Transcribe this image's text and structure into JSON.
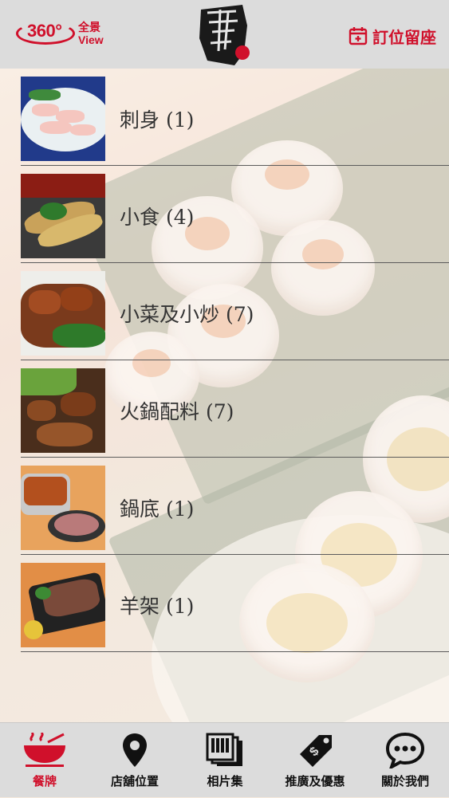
{
  "header": {
    "view360_number": "360°",
    "view360_label_line1": "全景",
    "view360_label_line2": "View",
    "reserve_label": "訂位留座",
    "accent_color": "#d0102b"
  },
  "menu": {
    "categories": [
      {
        "label": "刺身 (1)",
        "thumbnail": "sashimi-photo"
      },
      {
        "label": "小食 (4)",
        "thumbnail": "fried-snack-photo"
      },
      {
        "label": "小菜及小炒 (7)",
        "thumbnail": "stir-fry-photo"
      },
      {
        "label": "火鍋配料 (7)",
        "thumbnail": "hotpot-ingredients-photo"
      },
      {
        "label": "鍋底 (1)",
        "thumbnail": "soup-base-photo"
      },
      {
        "label": "羊架 (1)",
        "thumbnail": "lamb-rack-photo"
      }
    ]
  },
  "tabbar": {
    "tabs": [
      {
        "label": "餐牌",
        "icon": "bowl-icon",
        "active": true
      },
      {
        "label": "店舖位置",
        "icon": "map-pin-icon",
        "active": false
      },
      {
        "label": "相片集",
        "icon": "photo-gallery-icon",
        "active": false
      },
      {
        "label": "推廣及優惠",
        "icon": "price-tag-icon",
        "active": false
      },
      {
        "label": "關於我們",
        "icon": "chat-bubble-icon",
        "active": false
      }
    ]
  }
}
